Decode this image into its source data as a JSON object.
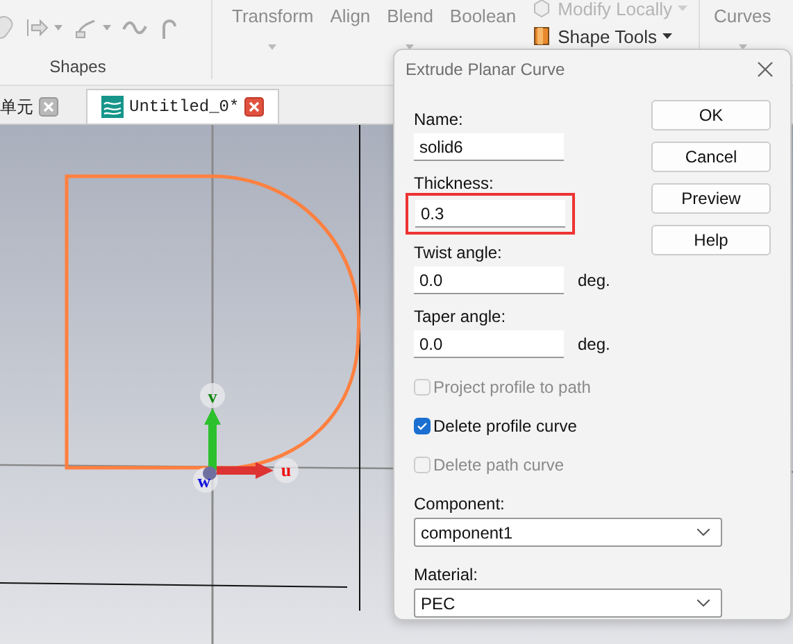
{
  "ribbon": {
    "left_tools": [
      {
        "kind": "pill",
        "has_dropdown": false
      },
      {
        "kind": "arrow",
        "has_dropdown": true
      },
      {
        "kind": "branch",
        "has_dropdown": true
      },
      {
        "kind": "wave",
        "has_dropdown": false
      },
      {
        "kind": "hook",
        "has_dropdown": false
      }
    ],
    "group_label": "Shapes",
    "tools": [
      {
        "label": "Transform",
        "has_dropdown": true
      },
      {
        "label": "Align",
        "has_dropdown": false
      },
      {
        "label": "Blend",
        "has_dropdown": true
      },
      {
        "label": "Boolean",
        "has_dropdown": false
      }
    ],
    "stacked_tools": [
      {
        "label": "Modify Locally",
        "has_dropdown": true,
        "disabled": true
      },
      {
        "label": "Shape Tools",
        "has_dropdown": true,
        "disabled": false
      }
    ],
    "right_tools": [
      {
        "label": "Curves",
        "has_dropdown": true
      }
    ]
  },
  "tabs": [
    {
      "label": "单元",
      "selected": false
    },
    {
      "label": "Untitled_0*",
      "selected": true
    }
  ],
  "viewport": {
    "axes": [
      {
        "kind": "v",
        "label": "v"
      },
      {
        "kind": "u",
        "label": "u"
      },
      {
        "kind": "w",
        "label": "w"
      }
    ]
  },
  "dialog": {
    "title": "Extrude Planar Curve",
    "fields": [
      {
        "label": "Name:",
        "value": "solid6",
        "highlighted": false
      },
      {
        "label": "Thickness:",
        "value": "0.3",
        "highlighted": true
      },
      {
        "label": "Twist angle:",
        "value": "0.0",
        "unit": "deg.",
        "highlighted": false
      },
      {
        "label": "Taper angle:",
        "value": "0.0",
        "unit": "deg.",
        "highlighted": false
      }
    ],
    "checkboxes": [
      {
        "label": "Project profile to path",
        "checked": false,
        "disabled": true
      },
      {
        "label": "Delete profile curve",
        "checked": true,
        "disabled": false
      },
      {
        "label": "Delete path curve",
        "checked": false,
        "disabled": true
      }
    ],
    "selects": [
      {
        "label": "Component:",
        "value": "component1"
      },
      {
        "label": "Material:",
        "value": "PEC"
      }
    ],
    "buttons": [
      "OK",
      "Cancel",
      "Preview",
      "Help"
    ]
  }
}
